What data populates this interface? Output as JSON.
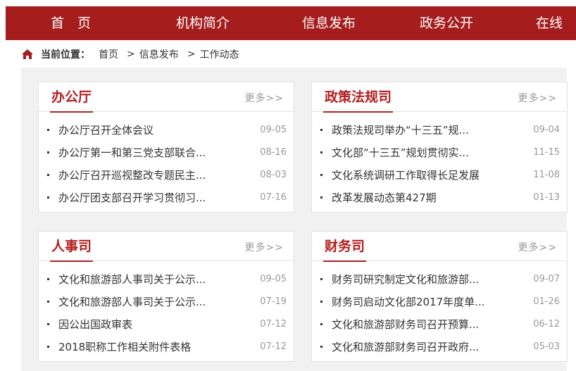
{
  "nav": {
    "items": [
      "首　页",
      "机构简介",
      "信息发布",
      "政务公开",
      "在线"
    ]
  },
  "breadcrumb": {
    "label": "当前位置：",
    "items": [
      "首页",
      "信息发布",
      "工作动态"
    ],
    "sep": ">"
  },
  "panels": [
    {
      "title": "办公厅",
      "more": "更多>>",
      "items": [
        {
          "text": "办公厅召开全体会议",
          "date": "09-05"
        },
        {
          "text": "办公厅第一和第三党支部联合...",
          "date": "08-16"
        },
        {
          "text": "办公厅召开巡视整改专题民主...",
          "date": "08-03"
        },
        {
          "text": "办公厅团支部召开学习贯彻习...",
          "date": "07-16"
        }
      ]
    },
    {
      "title": "政策法规司",
      "more": "更多>>",
      "items": [
        {
          "text": "政策法规司举办“十三五”规...",
          "date": "09-04"
        },
        {
          "text": "文化部“十三五”规划贯彻实...",
          "date": "11-15"
        },
        {
          "text": "文化系统调研工作取得长足发展",
          "date": "11-08"
        },
        {
          "text": "改革发展动态第427期",
          "date": "01-13"
        }
      ]
    },
    {
      "title": "人事司",
      "more": "更多>>",
      "items": [
        {
          "text": "文化和旅游部人事司关于公示...",
          "date": "09-05"
        },
        {
          "text": "文化和旅游部人事司关于公示...",
          "date": "07-19"
        },
        {
          "text": "因公出国政审表",
          "date": "07-12"
        },
        {
          "text": "2018职称工作相关附件表格",
          "date": "07-12"
        }
      ]
    },
    {
      "title": "财务司",
      "more": "更多>>",
      "items": [
        {
          "text": "财务司研究制定文化和旅游部...",
          "date": "09-07"
        },
        {
          "text": "财务司启动文化部2017年度单...",
          "date": "01-26"
        },
        {
          "text": "文化和旅游部财务司召开预算...",
          "date": "06-12"
        },
        {
          "text": "文化和旅游部财务司召开政府...",
          "date": "05-03"
        }
      ]
    }
  ],
  "colors": {
    "brand": "#a51d1d",
    "title": "#b21f1f",
    "muted": "#999999"
  }
}
